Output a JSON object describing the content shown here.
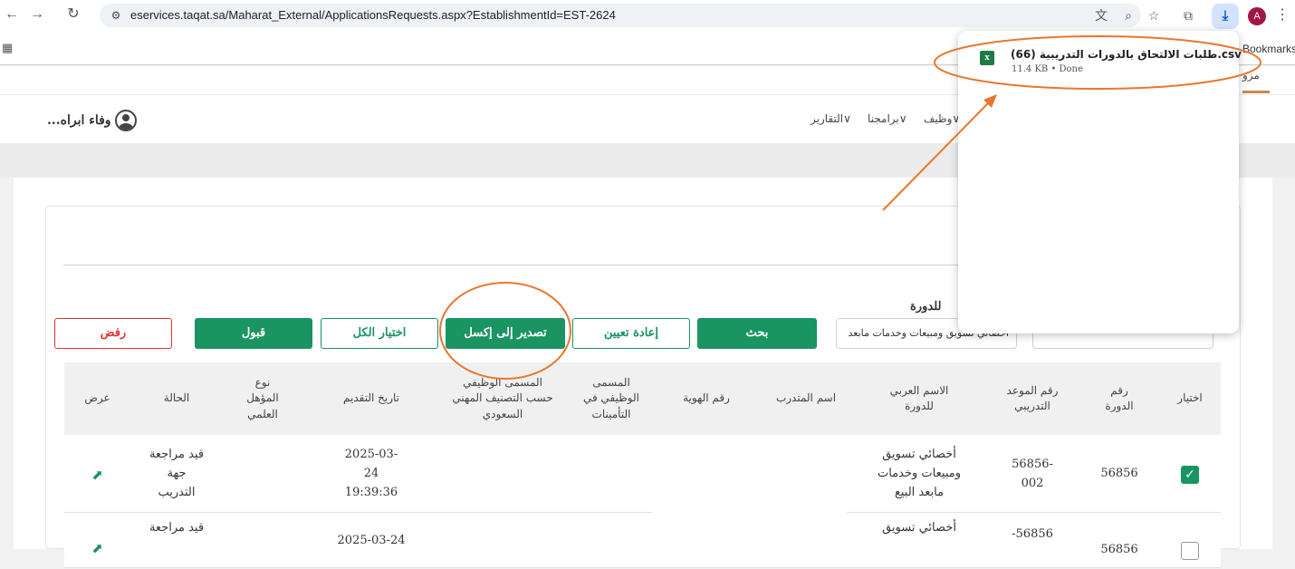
{
  "browser": {
    "url": "eservices.taqat.sa/Maharat_External/ApplicationsRequests.aspx?EstablishmentId=EST-2624",
    "bookmarks_label": "Bookmarks",
    "profile_initial": "A"
  },
  "download": {
    "file_name": "طلبات الالتحاق بالدورات التدريبية (66).csv",
    "meta": "11.4 KB • Done",
    "icon_text": "x"
  },
  "header": {
    "user_name": "وفاء ابراه...",
    "nav": {
      "reports": "التقارير",
      "programs": "برامجنا",
      "jobs": "وظيف",
      "right_fragment": "مزو"
    }
  },
  "filters": {
    "course_label": "للدورة",
    "course_value": "أخصائي تسويق ومبيعات وخدمات مابعد"
  },
  "buttons": {
    "reject": "رفض",
    "accept": "قبول",
    "select_all": "اختيار الكل",
    "export_excel": "تصدير إلى إكسل",
    "reset": "إعادة تعيين",
    "search": "بحث"
  },
  "table": {
    "headers": {
      "select": "اختيار",
      "course_no": "رقم الدورة",
      "session_no": "رقم الموعد التدريبي",
      "course_ar_name": "الاسم العربي للدورة",
      "trainee_name": "اسم المتدرب",
      "id_no": "رقم الهوية",
      "gosi_title": "المسمى الوظيفي في التأمينات",
      "saudi_title": "المسمى الوظيفي حسب التصنيف المهني السعودي",
      "apply_date": "تاريخ التقديم",
      "qualification": "نوع المؤهل العلمي",
      "status": "الحالة",
      "view": "عرض"
    },
    "rows": [
      {
        "checked": true,
        "course_no": "56856",
        "session_no": "56856-002",
        "course_ar_name": "أخصائي تسويق ومبيعات وخدمات مابعد البيع",
        "apply_date": "2025-03-24 19:39:36",
        "status": "قيد مراجعة جهة التدريب"
      },
      {
        "checked": false,
        "course_no": "56856",
        "session_no": "56856-",
        "course_ar_name": "أخصائي تسويق",
        "apply_date": "2025-03-24",
        "status": "قيد مراجعة"
      }
    ]
  },
  "colors": {
    "primary_green": "#1a9461",
    "reject_red": "#dd3333",
    "annotation_orange": "#e8772e"
  }
}
